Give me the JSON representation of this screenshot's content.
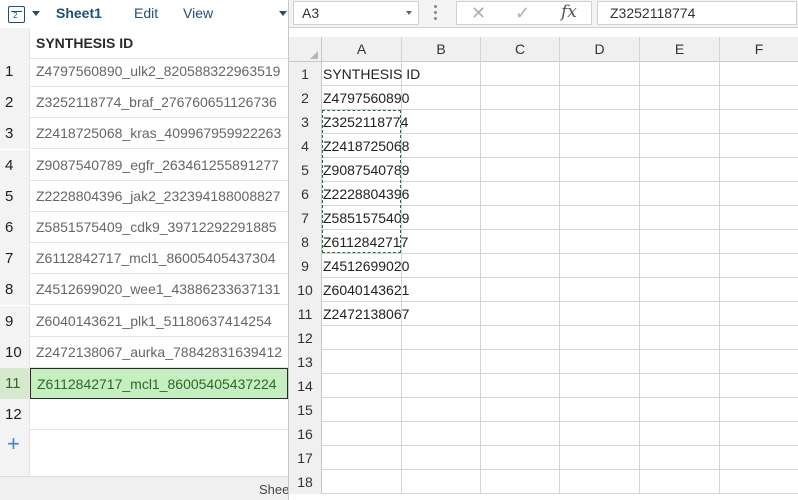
{
  "left": {
    "toolbar": {
      "sheet_icon_number": "2",
      "title": "Sheet1",
      "edit_label": "Edit",
      "view_label": "View"
    },
    "header_label": "SYNTHESIS ID",
    "header_row_number": "",
    "rows": [
      {
        "n": "1",
        "value": "Z4797560890_ulk2_820588322963519"
      },
      {
        "n": "2",
        "value": "Z3252118774_braf_276760651126736"
      },
      {
        "n": "3",
        "value": "Z2418725068_kras_409967959922263"
      },
      {
        "n": "4",
        "value": "Z9087540789_egfr_263461255891277"
      },
      {
        "n": "5",
        "value": "Z2228804396_jak2_232394188008827"
      },
      {
        "n": "6",
        "value": "Z5851575409_cdk9_39712292291885"
      },
      {
        "n": "7",
        "value": "Z6112842717_mcl1_86005405437304"
      },
      {
        "n": "8",
        "value": "Z4512699020_wee1_43886233637131"
      },
      {
        "n": "9",
        "value": "Z6040143621_plk1_51180637414254"
      },
      {
        "n": "10",
        "value": "Z2472138067_aurka_78842831639412"
      },
      {
        "n": "11",
        "value": "Z6112842717_mcl1_86005405437224"
      },
      {
        "n": "12",
        "value": ""
      }
    ],
    "add_icon": "plus-icon",
    "status_text": "Shee"
  },
  "right": {
    "namebox": "A3",
    "formula_value": "Z3252118774",
    "fx_label": "fx",
    "columns": [
      "A",
      "B",
      "C",
      "D",
      "E",
      "F"
    ],
    "rows": [
      {
        "n": "1",
        "a": "SYNTHESIS ID"
      },
      {
        "n": "2",
        "a": "Z4797560890"
      },
      {
        "n": "3",
        "a": "Z3252118774"
      },
      {
        "n": "4",
        "a": "Z2418725068"
      },
      {
        "n": "5",
        "a": "Z9087540789"
      },
      {
        "n": "6",
        "a": "Z2228804396"
      },
      {
        "n": "7",
        "a": "Z5851575409"
      },
      {
        "n": "8",
        "a": "Z6112842717"
      },
      {
        "n": "9",
        "a": "Z4512699020"
      },
      {
        "n": "10",
        "a": "Z6040143621"
      },
      {
        "n": "11",
        "a": "Z2472138067"
      },
      {
        "n": "12",
        "a": ""
      },
      {
        "n": "13",
        "a": ""
      },
      {
        "n": "14",
        "a": ""
      },
      {
        "n": "15",
        "a": ""
      },
      {
        "n": "16",
        "a": ""
      },
      {
        "n": "17",
        "a": ""
      },
      {
        "n": "18",
        "a": ""
      }
    ]
  },
  "colors": {
    "accent_blue": "#1f4e79",
    "selection_green": "#c6efc1",
    "copy_border": "#2e6b3a"
  }
}
